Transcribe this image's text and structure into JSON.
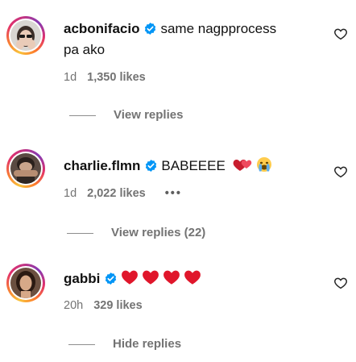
{
  "comments": [
    {
      "username": "acbonifacio",
      "text_line1": "same nagpprocess",
      "text_line2": "pa ako",
      "time": "1d",
      "likes": "1,350 likes",
      "replies_label": "View replies"
    },
    {
      "username": "charlie.flmn",
      "text": "BABEEEE",
      "emojis": [
        "red-heart-two-hearts",
        "crying-face"
      ],
      "time": "1d",
      "likes": "2,022 likes",
      "more": "•••",
      "replies_label": "View replies (22)"
    },
    {
      "username": "gabbi",
      "emojis": [
        "red-heart",
        "red-heart",
        "red-heart",
        "red-heart"
      ],
      "time": "20h",
      "likes": "329 likes",
      "replies_label": "Hide replies"
    }
  ],
  "colors": {
    "verified": "#0095f6",
    "meta_text": "#737373",
    "heart_emoji": "#e0162b"
  }
}
